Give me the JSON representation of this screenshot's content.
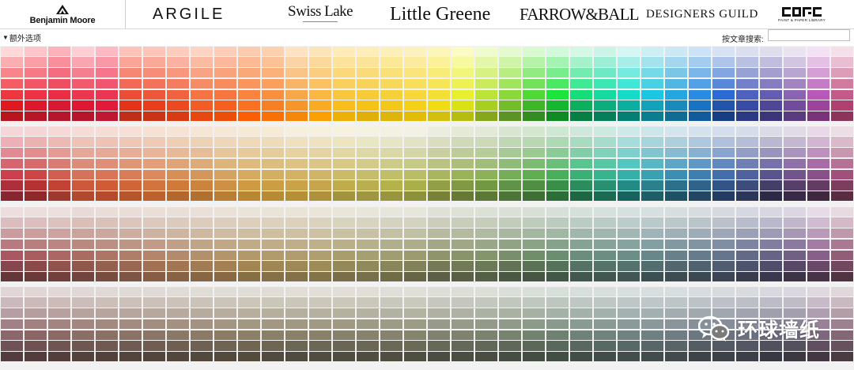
{
  "brands": {
    "benjamin_moore": "Benjamin Moore",
    "argile": "ARGILE",
    "swiss_lake": "Swiss Lake",
    "little_greene": "Little Greene",
    "farrow_ball": "FARROW&BALL",
    "designers_guild": "DESIGNERS GUILD",
    "cole_son_tagline": "PAINT & PAPER LIBRARY"
  },
  "toolbar": {
    "extra_options_label": "额外选项",
    "search_label": "按文章搜索:",
    "search_value": ""
  },
  "watermark": {
    "text": "环球墙纸",
    "icon": "wechat-icon"
  },
  "palette": {
    "columns": 36,
    "rows_per_band": 7,
    "bands": [
      {
        "hues": [
          358,
          354,
          352,
          352,
          350,
          8,
          10,
          12,
          16,
          18,
          22,
          26,
          32,
          38,
          44,
          46,
          48,
          50,
          54,
          62,
          74,
          90,
          110,
          130,
          150,
          162,
          174,
          188,
          198,
          208,
          218,
          230,
          246,
          268,
          300,
          334
        ],
        "top": [
          [
            94,
            92
          ],
          [
            93,
            88
          ],
          [
            92,
            84
          ],
          [
            92,
            90
          ],
          [
            93,
            86
          ],
          [
            93,
            86
          ],
          [
            93,
            86
          ],
          [
            92,
            87
          ],
          [
            93,
            88
          ],
          [
            92,
            86
          ],
          [
            92,
            84
          ],
          [
            94,
            84
          ],
          [
            92,
            88
          ],
          [
            92,
            86
          ],
          [
            94,
            86
          ],
          [
            92,
            86
          ],
          [
            94,
            86
          ],
          [
            92,
            87
          ],
          [
            92,
            86
          ],
          [
            88,
            88
          ],
          [
            84,
            90
          ],
          [
            82,
            90
          ],
          [
            78,
            90
          ],
          [
            76,
            90
          ],
          [
            70,
            90
          ],
          [
            66,
            88
          ],
          [
            64,
            90
          ],
          [
            64,
            88
          ],
          [
            64,
            88
          ],
          [
            68,
            88
          ],
          [
            58,
            90
          ],
          [
            40,
            90
          ],
          [
            30,
            90
          ],
          [
            30,
            92
          ],
          [
            40,
            92
          ],
          [
            50,
            92
          ]
        ],
        "bottom": [
          [
            78,
            40
          ],
          [
            78,
            40
          ],
          [
            78,
            40
          ],
          [
            78,
            40
          ],
          [
            78,
            42
          ],
          [
            78,
            42
          ],
          [
            80,
            44
          ],
          [
            84,
            46
          ],
          [
            88,
            48
          ],
          [
            92,
            48
          ],
          [
            96,
            50
          ],
          [
            94,
            50
          ],
          [
            92,
            50
          ],
          [
            96,
            50
          ],
          [
            94,
            48
          ],
          [
            92,
            46
          ],
          [
            90,
            46
          ],
          [
            92,
            46
          ],
          [
            88,
            44
          ],
          [
            84,
            40
          ],
          [
            72,
            38
          ],
          [
            60,
            36
          ],
          [
            62,
            34
          ],
          [
            80,
            30
          ],
          [
            90,
            26
          ],
          [
            90,
            26
          ],
          [
            92,
            26
          ],
          [
            86,
            30
          ],
          [
            80,
            32
          ],
          [
            80,
            34
          ],
          [
            70,
            30
          ],
          [
            50,
            34
          ],
          [
            38,
            34
          ],
          [
            36,
            36
          ],
          [
            40,
            34
          ],
          [
            46,
            38
          ]
        ]
      },
      {
        "hues": [
          354,
          0,
          6,
          12,
          14,
          18,
          22,
          26,
          30,
          34,
          38,
          40,
          42,
          44,
          50,
          54,
          58,
          62,
          68,
          76,
          86,
          100,
          110,
          130,
          150,
          162,
          176,
          188,
          198,
          206,
          216,
          226,
          246,
          272,
          300,
          330
        ],
        "top": [
          [
            62,
            90
          ],
          [
            60,
            90
          ],
          [
            60,
            90
          ],
          [
            60,
            90
          ],
          [
            62,
            90
          ],
          [
            62,
            90
          ],
          [
            64,
            90
          ],
          [
            64,
            90
          ],
          [
            62,
            90
          ],
          [
            62,
            90
          ],
          [
            62,
            90
          ],
          [
            60,
            90
          ],
          [
            60,
            92
          ],
          [
            58,
            92
          ],
          [
            56,
            92
          ],
          [
            48,
            92
          ],
          [
            40,
            92
          ],
          [
            34,
            92
          ],
          [
            30,
            90
          ],
          [
            30,
            88
          ],
          [
            30,
            88
          ],
          [
            30,
            86
          ],
          [
            34,
            86
          ],
          [
            36,
            86
          ],
          [
            38,
            86
          ],
          [
            40,
            86
          ],
          [
            40,
            86
          ],
          [
            40,
            86
          ],
          [
            40,
            88
          ],
          [
            42,
            88
          ],
          [
            40,
            88
          ],
          [
            30,
            88
          ],
          [
            22,
            88
          ],
          [
            22,
            88
          ],
          [
            26,
            88
          ],
          [
            30,
            90
          ]
        ],
        "bottom": [
          [
            56,
            34
          ],
          [
            56,
            36
          ],
          [
            56,
            40
          ],
          [
            58,
            44
          ],
          [
            62,
            44
          ],
          [
            62,
            44
          ],
          [
            62,
            46
          ],
          [
            60,
            44
          ],
          [
            56,
            44
          ],
          [
            56,
            46
          ],
          [
            58,
            46
          ],
          [
            56,
            46
          ],
          [
            54,
            46
          ],
          [
            50,
            46
          ],
          [
            46,
            44
          ],
          [
            42,
            44
          ],
          [
            42,
            42
          ],
          [
            42,
            40
          ],
          [
            40,
            36
          ],
          [
            40,
            34
          ],
          [
            40,
            34
          ],
          [
            36,
            34
          ],
          [
            36,
            32
          ],
          [
            44,
            30
          ],
          [
            56,
            26
          ],
          [
            60,
            26
          ],
          [
            62,
            24
          ],
          [
            56,
            26
          ],
          [
            54,
            26
          ],
          [
            50,
            26
          ],
          [
            46,
            26
          ],
          [
            34,
            26
          ],
          [
            26,
            22
          ],
          [
            26,
            22
          ],
          [
            24,
            20
          ],
          [
            34,
            26
          ]
        ]
      },
      {
        "hues": [
          354,
          0,
          4,
          10,
          14,
          18,
          22,
          26,
          30,
          34,
          38,
          40,
          42,
          44,
          48,
          52,
          56,
          60,
          66,
          74,
          84,
          96,
          110,
          130,
          150,
          160,
          172,
          184,
          196,
          206,
          216,
          228,
          246,
          268,
          300,
          330
        ],
        "top": [
          [
            32,
            90
          ],
          [
            30,
            90
          ],
          [
            30,
            90
          ],
          [
            30,
            88
          ],
          [
            30,
            88
          ],
          [
            30,
            88
          ],
          [
            32,
            88
          ],
          [
            32,
            88
          ],
          [
            32,
            88
          ],
          [
            32,
            88
          ],
          [
            32,
            88
          ],
          [
            32,
            88
          ],
          [
            32,
            88
          ],
          [
            30,
            88
          ],
          [
            28,
            88
          ],
          [
            24,
            88
          ],
          [
            20,
            88
          ],
          [
            18,
            88
          ],
          [
            16,
            86
          ],
          [
            16,
            86
          ],
          [
            16,
            86
          ],
          [
            14,
            86
          ],
          [
            14,
            86
          ],
          [
            14,
            86
          ],
          [
            14,
            86
          ],
          [
            14,
            86
          ],
          [
            14,
            86
          ],
          [
            14,
            86
          ],
          [
            14,
            86
          ],
          [
            14,
            86
          ],
          [
            14,
            86
          ],
          [
            16,
            86
          ],
          [
            16,
            86
          ],
          [
            16,
            86
          ],
          [
            18,
            88
          ],
          [
            22,
            88
          ]
        ],
        "bottom": [
          [
            30,
            30
          ],
          [
            30,
            32
          ],
          [
            30,
            34
          ],
          [
            30,
            34
          ],
          [
            30,
            36
          ],
          [
            30,
            38
          ],
          [
            32,
            40
          ],
          [
            32,
            40
          ],
          [
            32,
            40
          ],
          [
            32,
            40
          ],
          [
            32,
            40
          ],
          [
            30,
            40
          ],
          [
            28,
            40
          ],
          [
            28,
            40
          ],
          [
            24,
            38
          ],
          [
            22,
            38
          ],
          [
            20,
            36
          ],
          [
            18,
            34
          ],
          [
            16,
            32
          ],
          [
            16,
            32
          ],
          [
            16,
            32
          ],
          [
            14,
            30
          ],
          [
            14,
            30
          ],
          [
            14,
            30
          ],
          [
            14,
            30
          ],
          [
            14,
            30
          ],
          [
            14,
            30
          ],
          [
            14,
            28
          ],
          [
            14,
            28
          ],
          [
            16,
            28
          ],
          [
            18,
            28
          ],
          [
            16,
            26
          ],
          [
            16,
            26
          ],
          [
            16,
            24
          ],
          [
            18,
            24
          ],
          [
            22,
            26
          ]
        ]
      },
      {
        "hues": [
          350,
          0,
          6,
          12,
          16,
          20,
          24,
          28,
          32,
          36,
          40,
          42,
          44,
          46,
          48,
          52,
          56,
          60,
          66,
          74,
          84,
          96,
          110,
          130,
          150,
          162,
          174,
          186,
          196,
          206,
          216,
          228,
          240,
          260,
          300,
          330
        ],
        "top": [
          [
            14,
            86
          ],
          [
            14,
            86
          ],
          [
            14,
            86
          ],
          [
            14,
            86
          ],
          [
            14,
            86
          ],
          [
            14,
            86
          ],
          [
            14,
            86
          ],
          [
            14,
            86
          ],
          [
            14,
            86
          ],
          [
            14,
            86
          ],
          [
            14,
            86
          ],
          [
            14,
            86
          ],
          [
            14,
            86
          ],
          [
            14,
            86
          ],
          [
            14,
            86
          ],
          [
            12,
            86
          ],
          [
            10,
            86
          ],
          [
            10,
            86
          ],
          [
            8,
            86
          ],
          [
            8,
            86
          ],
          [
            8,
            86
          ],
          [
            8,
            86
          ],
          [
            8,
            86
          ],
          [
            8,
            86
          ],
          [
            8,
            86
          ],
          [
            8,
            86
          ],
          [
            8,
            86
          ],
          [
            8,
            86
          ],
          [
            8,
            86
          ],
          [
            8,
            86
          ],
          [
            8,
            86
          ],
          [
            8,
            86
          ],
          [
            8,
            86
          ],
          [
            8,
            86
          ],
          [
            10,
            86
          ],
          [
            12,
            86
          ]
        ],
        "bottom": [
          [
            16,
            28
          ],
          [
            16,
            28
          ],
          [
            16,
            28
          ],
          [
            16,
            28
          ],
          [
            16,
            28
          ],
          [
            16,
            28
          ],
          [
            16,
            28
          ],
          [
            16,
            28
          ],
          [
            16,
            28
          ],
          [
            16,
            28
          ],
          [
            16,
            28
          ],
          [
            14,
            28
          ],
          [
            12,
            28
          ],
          [
            12,
            28
          ],
          [
            10,
            28
          ],
          [
            10,
            28
          ],
          [
            10,
            28
          ],
          [
            10,
            28
          ],
          [
            8,
            28
          ],
          [
            8,
            28
          ],
          [
            8,
            28
          ],
          [
            8,
            28
          ],
          [
            8,
            28
          ],
          [
            8,
            28
          ],
          [
            8,
            28
          ],
          [
            8,
            28
          ],
          [
            8,
            28
          ],
          [
            8,
            28
          ],
          [
            8,
            28
          ],
          [
            8,
            26
          ],
          [
            8,
            26
          ],
          [
            8,
            26
          ],
          [
            8,
            24
          ],
          [
            8,
            24
          ],
          [
            10,
            24
          ],
          [
            12,
            26
          ]
        ]
      }
    ]
  }
}
